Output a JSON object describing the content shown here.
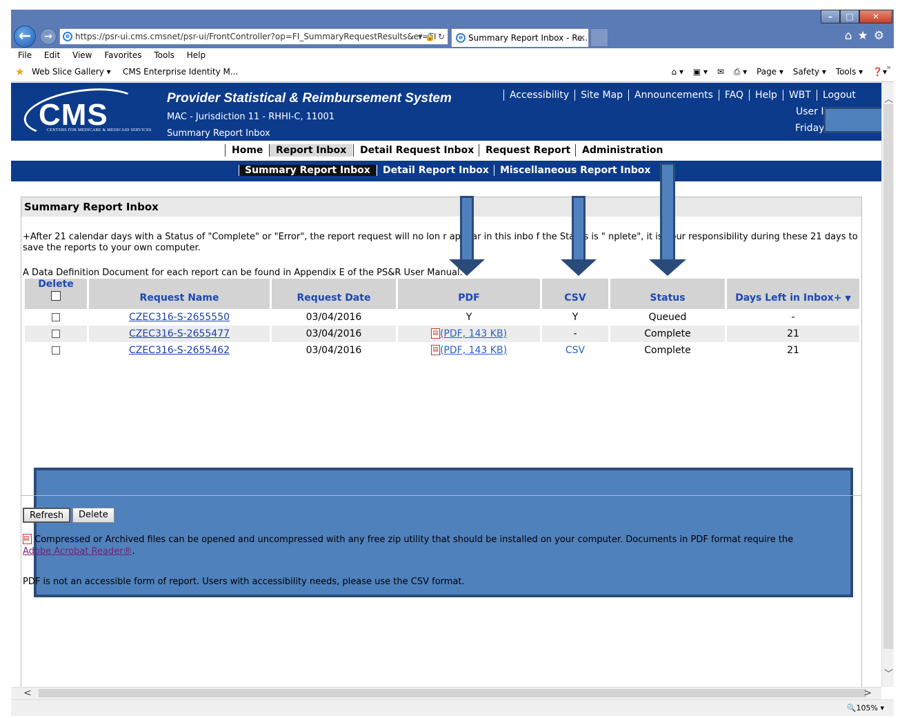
{
  "browser": {
    "url": "https://psr-ui.cms.cmsnet/psr-ui/FrontController?op=FI_SummaryRequestResults&er=FI",
    "tab_title": "Summary Report Inbox - Re...",
    "menu": [
      "File",
      "Edit",
      "View",
      "Favorites",
      "Tools",
      "Help"
    ],
    "favorites": [
      "Web Slice Gallery ▾",
      "CMS Enterprise Identity M..."
    ],
    "command_bar": [
      "Page ▾",
      "Safety ▾",
      "Tools ▾"
    ],
    "zoom": "105%"
  },
  "header": {
    "logo_text": "CMS",
    "logo_subtext": "CENTERS FOR MEDICARE & MEDICAID SERVICES",
    "system_title": "Provider Statistical & Reimbursement System",
    "jurisdiction": "MAC - Jurisdiction 11 - RHHI-C, 11001",
    "subtitle": "Summary Report Inbox",
    "top_links": [
      "Accessibility",
      "Site Map",
      "Announcements",
      "FAQ",
      "Help",
      "WBT",
      "Logout"
    ],
    "user_id_label": "User ID",
    "day_label": "Friday"
  },
  "primary_nav": {
    "home": "Home",
    "report_inbox": "Report Inbox",
    "detail_request_inbox": "Detail Request Inbox",
    "request_report": "Request Report",
    "administration": "Administration"
  },
  "secondary_nav": {
    "summary": "Summary Report Inbox",
    "detail": "Detail Report Inbox",
    "misc": "Miscellaneous Report Inbox"
  },
  "main": {
    "title": "Summary Report Inbox",
    "notice": "+After 21 calendar days with a Status of \"Complete\" or \"Error\", the report request will no lon   r appear in this inbo   f the Status is \"    nplete\", it is your responsibility during these 21 days to save the reports to your own computer.",
    "dd_note": "A Data Definition Document for each report can be found in Appendix E of the PS&R User Manual.",
    "columns": {
      "delete": "Delete",
      "request_name": "Request Name",
      "request_date": "Request Date",
      "pdf": "PDF",
      "csv": "CSV",
      "status": "Status",
      "days_left": "Days Left in Inbox+"
    },
    "rows": [
      {
        "request_name": "CZEC316-S-2655550",
        "request_date": "03/04/2016",
        "pdf": "Y",
        "csv": "Y",
        "status": "Queued",
        "days_left": "-"
      },
      {
        "request_name": "CZEC316-S-2655477",
        "request_date": "03/04/2016",
        "pdf": "(PDF, 143 KB)",
        "csv": "-",
        "status": "Complete",
        "days_left": "21"
      },
      {
        "request_name": "CZEC316-S-2655462",
        "request_date": "03/04/2016",
        "pdf": "(PDF, 143 KB)",
        "csv": "CSV",
        "status": "Complete",
        "days_left": "21"
      }
    ],
    "buttons": {
      "refresh": "Refresh",
      "delete": "Delete"
    },
    "zip_note": "Compressed or Archived files can be opened and uncompressed with any free zip utility that should be installed on your computer. Documents in PDF format require the",
    "acrobat_link": "Adobe Acrobat Reader®",
    "access_note": "PDF is not an accessible form of report. Users with accessibility needs, please use the CSV format."
  },
  "colors": {
    "cms_blue": "#0c3b8c",
    "redaction": "#4f81bd",
    "link": "#1c3fb0",
    "header_text": "#1a48b5"
  }
}
